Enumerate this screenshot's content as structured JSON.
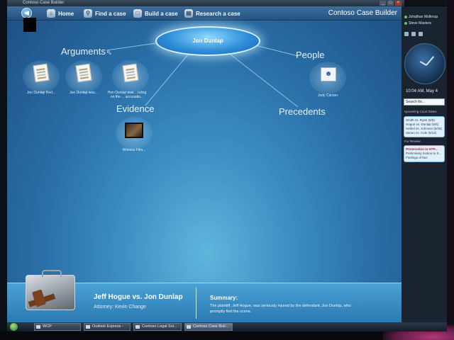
{
  "window": {
    "title": "Contoso Case Builder",
    "buttons": [
      "_",
      "□",
      "×"
    ]
  },
  "toolbar": {
    "back_icon": "back-arrow-icon",
    "nav": [
      {
        "label": "Home",
        "icon": "home-icon"
      },
      {
        "label": "Find a case",
        "icon": "magnifier-icon"
      },
      {
        "label": "Build a case",
        "icon": "build-icon"
      },
      {
        "label": "Research a case",
        "icon": "research-icon"
      }
    ],
    "app_name": "Contoso Case Builder"
  },
  "center_node": {
    "label": "Jon Dunlap"
  },
  "categories": {
    "arguments": "Arguments",
    "people": "People",
    "evidence": "Evidence",
    "precedents": "Precedents"
  },
  "documents": [
    {
      "label": "Jon Dunlap Red...",
      "icon": "document-icon"
    },
    {
      "label": "Jon Dunlap was...",
      "icon": "document-icon"
    },
    {
      "label": "Hon Dunlap was... ruling on the ... accusatio...",
      "icon": "document-icon"
    }
  ],
  "evidence_item": {
    "label": "Witness Film...",
    "icon": "film-icon"
  },
  "person_item": {
    "label": "Jody Carson",
    "icon": "person-card-icon"
  },
  "footer": {
    "case_title": "Jeff Hogue vs. Jon Dunlap",
    "attorney": "Attorney: Kevin Change",
    "summary_heading": "Summary:",
    "summary_text": "The plaintiff, Jeff Hogue, was seriously injured by the defendant, Jon Dunlap, who promptly fled the scene."
  },
  "sidebar": {
    "contacts": [
      "Johathan Mollerup",
      "Steve Masters"
    ],
    "clock_time": "10:04 AM, May 4",
    "search_placeholder": "Search for...",
    "court_heading": "Upcoming Court Dates",
    "court_dates": [
      "Smith vs. Ryan (5/5)",
      "Hogue vs. Dunlap (5/5)",
      "Haibel vs. Johnson (5/26)",
      "Simon vs. Cole (5/12)"
    ],
    "review_heading": "For Review",
    "review_title": "Prosecution in HTP...",
    "review_lines": [
      "Preliminary motion to S...",
      "Findings of fact"
    ]
  },
  "taskbar": {
    "items": [
      "WCP",
      "Outlook Express -",
      "Contoso Legal Sol...",
      "Contoso Case Buil..."
    ],
    "active_index": 3
  },
  "colors": {
    "background_top": "#1d4f82",
    "background_glow": "#5fb6dc",
    "node_fill": "#2f8fd8",
    "footer": "#3f93c8",
    "sidebar": "#1a2430"
  }
}
